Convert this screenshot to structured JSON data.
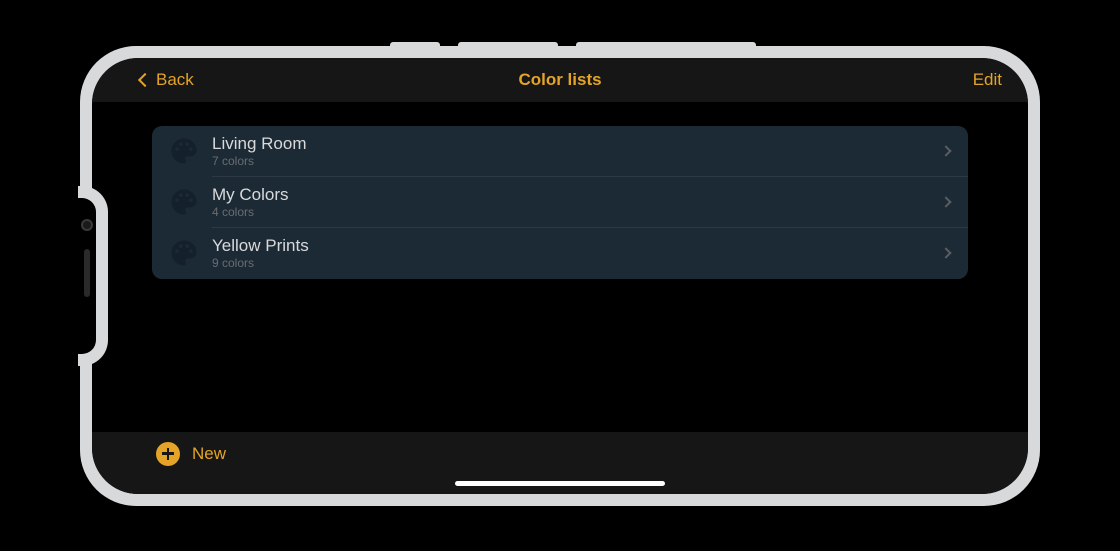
{
  "nav": {
    "back_label": "Back",
    "title": "Color lists",
    "edit_label": "Edit"
  },
  "lists": [
    {
      "title": "Living Room",
      "subtitle": "7 colors"
    },
    {
      "title": "My Colors",
      "subtitle": "4 colors"
    },
    {
      "title": "Yellow Prints",
      "subtitle": "9 colors"
    }
  ],
  "toolbar": {
    "new_label": "New"
  },
  "colors": {
    "accent": "#e5a327",
    "card_bg": "#1c2a36",
    "screen_bg": "#000000",
    "bar_bg": "#161616"
  }
}
